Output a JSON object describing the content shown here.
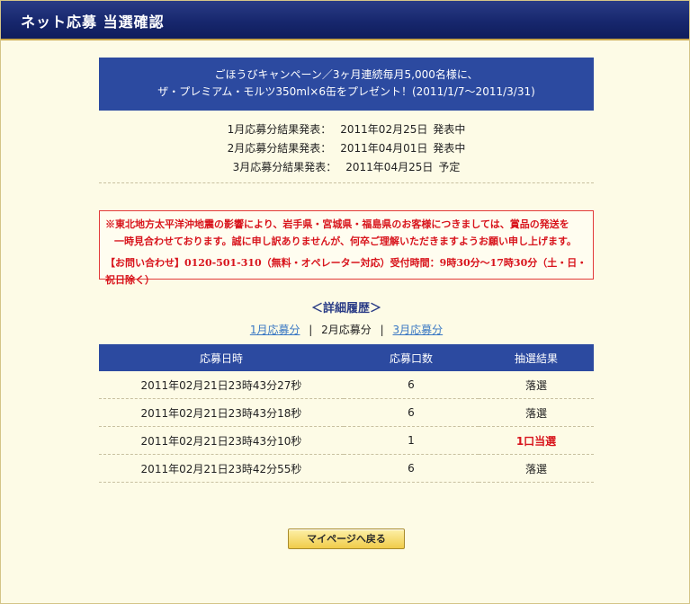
{
  "window": {
    "title": "ネット応募 当選確認"
  },
  "banner": {
    "line1": "ごほうびキャンペーン／3ヶ月連続毎月5,000名様に、",
    "line2": "ザ・プレミアム・モルツ350ml×6缶をプレゼント！(2011/1/7〜2011/3/31)"
  },
  "announcements": [
    {
      "label": "1月応募分結果発表：",
      "date": "2011年02月25日",
      "status": "発表中"
    },
    {
      "label": "2月応募分結果発表：",
      "date": "2011年04月01日",
      "status": "発表中"
    },
    {
      "label": "3月応募分結果発表：",
      "date": "2011年04月25日",
      "status": "予定"
    }
  ],
  "notice": {
    "line1": "※東北地方太平洋沖地震の影響により、岩手県・宮城県・福島県のお客様につきましては、賞品の発送を",
    "line2": "一時見合わせております。誠に申し訳ありませんが、何卒ご理解いただきますようお願い申し上げます。",
    "contact": "【お問い合わせ】0120-501-310（無料・オペレーター対応）受付時間：9時30分〜17時30分（土・日・祝日除く）"
  },
  "detail": {
    "heading": "＜詳細履歴＞",
    "tabs": [
      "1月応募分",
      "2月応募分",
      "3月応募分"
    ],
    "separator": "|"
  },
  "table": {
    "headers": [
      "応募日時",
      "応募口数",
      "抽選結果"
    ],
    "rows": [
      {
        "datetime": "2011年02月21日23時43分27秒",
        "count": "6",
        "result": "落選"
      },
      {
        "datetime": "2011年02月21日23時43分18秒",
        "count": "6",
        "result": "落選"
      },
      {
        "datetime": "2011年02月21日23時43分10秒",
        "count": "1",
        "result": "1口当選"
      },
      {
        "datetime": "2011年02月21日23時42分55秒",
        "count": "6",
        "result": "落選"
      }
    ]
  },
  "back_button": {
    "label": "マイページへ戻る"
  },
  "colors": {
    "header_navy": "#17276d",
    "banner_blue": "#2c4aa0",
    "notice_red": "#d8141c",
    "page_bg": "#fdfbe6",
    "link_blue": "#3a78c4"
  }
}
